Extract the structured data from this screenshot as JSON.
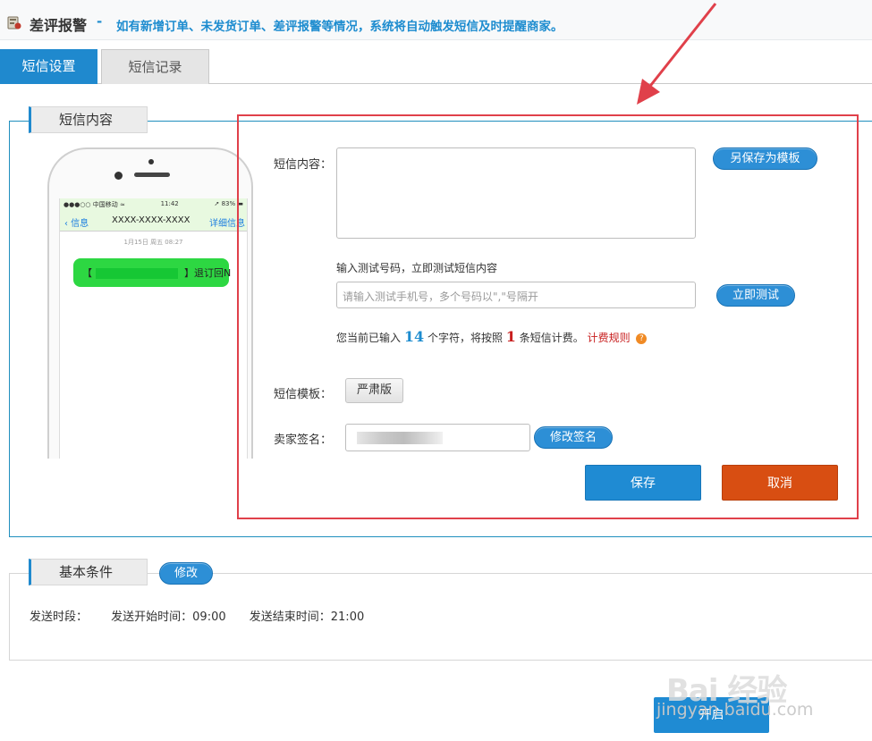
{
  "header": {
    "title": "差评报警",
    "dash": "-",
    "description": "如有新增订单、未发货订单、差评报警等情况，系统将自动触发短信及时提醒商家。"
  },
  "tabs": [
    {
      "label": "短信设置",
      "active": true
    },
    {
      "label": "短信记录",
      "active": false
    }
  ],
  "sms_panel": {
    "legend": "短信内容",
    "phone": {
      "carrier": "●●●○○ 中国移动 ≈",
      "time": "11:42",
      "battery": "➚ 83% ▬",
      "back_label": "‹ 信息",
      "contact": "XXXX-XXXX-XXXX",
      "detail_label": "详细信息",
      "timestamp": "1月15日 周五 08:27",
      "bubble_left": "【",
      "bubble_right": "】退订回N"
    },
    "content_label": "短信内容：",
    "content_value": "",
    "save_template_label": "另保存为模板",
    "test_hint": "输入测试号码，立即测试短信内容",
    "test_placeholder": "请输入测试手机号，多个号码以\",\"号隔开",
    "test_button_label": "立即测试",
    "count_prefix": "您当前已输入",
    "char_count": "14",
    "count_mid": "个字符，将按照",
    "sms_count": "1",
    "count_suffix": "条短信计费。",
    "billing_rule_label": "计费规则",
    "help_glyph": "?",
    "template_label": "短信模板：",
    "template_value": "严肃版",
    "signature_label": "卖家签名：",
    "modify_signature_label": "修改签名",
    "save_label": "保存",
    "cancel_label": "取消"
  },
  "conditions_panel": {
    "legend": "基本条件",
    "modify_label": "修改",
    "period_label": "发送时段：",
    "start_time_text": "发送开始时间：09:00",
    "end_time_text": "发送结束时间：21:00"
  },
  "bottom": {
    "start_label": "开启"
  },
  "watermark": {
    "brand": "Bai 经验",
    "url": "jingyan.baidu.com"
  },
  "colors": {
    "accent_blue": "#1f89ce",
    "cancel_orange": "#d84e12",
    "annotation_red": "#e0404a"
  }
}
